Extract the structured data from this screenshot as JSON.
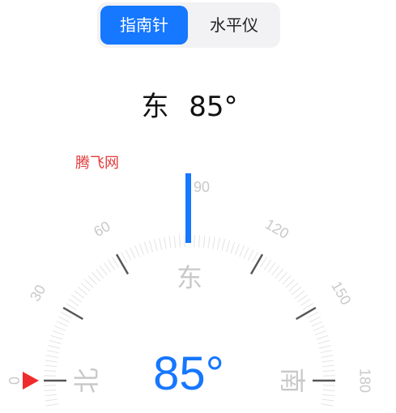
{
  "tabs": {
    "compass_label": "指南针",
    "level_label": "水平仪"
  },
  "heading": {
    "direction": "东",
    "degrees": "85°"
  },
  "watermark": "腾飞网",
  "dial": {
    "heading_deg": 85,
    "labels": [
      {
        "deg": 0,
        "text": "0"
      },
      {
        "deg": 30,
        "text": "30"
      },
      {
        "deg": 60,
        "text": "60"
      },
      {
        "deg": 90,
        "text": "90"
      },
      {
        "deg": 120,
        "text": "120"
      },
      {
        "deg": 150,
        "text": "150"
      },
      {
        "deg": 180,
        "text": "180"
      }
    ],
    "cardinals": [
      {
        "deg": 0,
        "text": "北"
      },
      {
        "deg": 90,
        "text": "东"
      },
      {
        "deg": 180,
        "text": "南"
      }
    ],
    "tick_color": "#e3e3e3",
    "major_tick_color": "#555555",
    "label_color": "#c9c9c9",
    "pointer_color": "#1677ff",
    "north_marker_color": "#f02b2b"
  },
  "reading": "85°"
}
